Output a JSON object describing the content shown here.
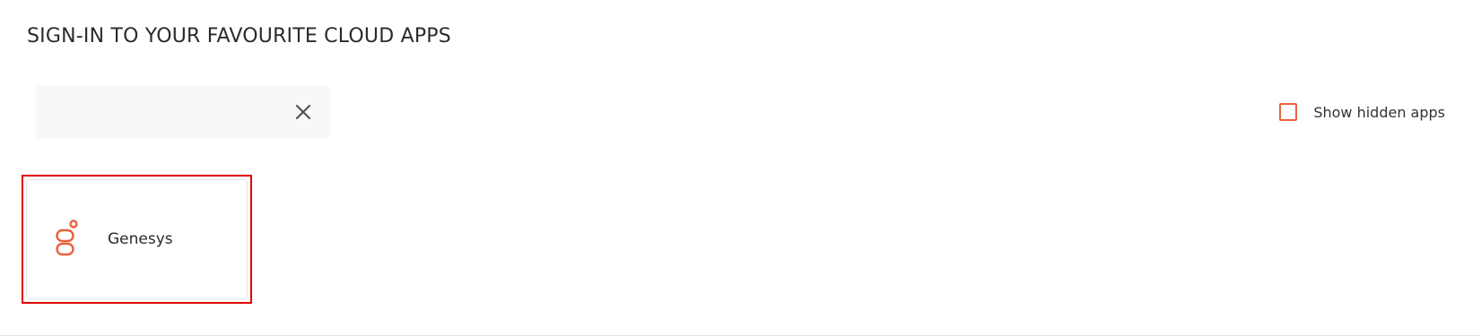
{
  "header": {
    "title": "SIGN-IN TO YOUR FAVOURITE CLOUD APPS"
  },
  "search": {
    "value": "",
    "placeholder": ""
  },
  "clear_icon": "close-icon",
  "show_hidden": {
    "label": "Show hidden apps",
    "checked": false
  },
  "apps": [
    {
      "name": "Genesys",
      "icon": "genesys-logo-icon"
    }
  ],
  "colors": {
    "accent": "#e8623d",
    "highlight": "#e00000",
    "title_text": "#2b2b2b",
    "search_bg": "#f6f8f9"
  }
}
